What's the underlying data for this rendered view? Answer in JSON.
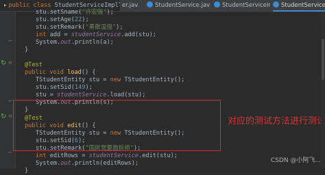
{
  "editor": {
    "class_header": {
      "modifiers": "public class",
      "class_name": "StudentServiceImplTest",
      "brace": "{"
    },
    "tabs": [
      {
        "label": "er.java",
        "close": "×",
        "active": false
      },
      {
        "label": "StudentService.java",
        "close": "×",
        "active": false
      },
      {
        "label": "StudentServiceImpl.java",
        "close": "×",
        "active": false
      },
      {
        "label": "StudentServiceImplT",
        "close": "",
        "active": true
      }
    ]
  },
  "code": {
    "add_block": {
      "l1": {
        "pre": "stu.setSname(",
        "str": "\"许宏强\"",
        "post": ");"
      },
      "l2": {
        "pre": "stu.setAge(",
        "num": "22",
        "post": ");"
      },
      "l3": {
        "pre": "stu.setRemark(",
        "str": "\"勇敢温强\"",
        "post": ");"
      },
      "l4": {
        "kw": "int",
        "pre": " add = ",
        "fld": "studentService",
        "post": ".add(stu);"
      },
      "l5": {
        "pre": "System.",
        "fld": "out",
        "post": ".println(a);"
      },
      "l6": {
        "text": "}"
      }
    },
    "load_block": {
      "ann": "@Test",
      "sig": {
        "kw": "public void",
        "fn": "load",
        "post": "() {"
      },
      "l1": {
        "pre": "TStudentEntity stu = ",
        "kw": "new",
        "post": " TStudentEntity();"
      },
      "l2": {
        "pre": "stu.setSid(",
        "num": "149",
        "post": ");"
      },
      "l3": {
        "pre": "stu = ",
        "fld": "studentService",
        "post": ".load(stu);"
      },
      "l4": {
        "pre": "System.",
        "fld": "out",
        "post": ".println(s);"
      },
      "l5": {
        "text": "}"
      }
    },
    "edit_block": {
      "ann": "@Test",
      "sig": {
        "kw": "public void",
        "fn": "edit",
        "post": "() {"
      },
      "l1": {
        "pre": "TStudentEntity stu = ",
        "kw": "new",
        "post": " TStudentEntity();"
      },
      "l2": {
        "pre": "stu.setSid(",
        "num": "6",
        "post": ");"
      },
      "l3": {
        "pre": "stu.setRemark(",
        "str": "\"国民党要面拆师\"",
        "post": ");"
      },
      "l4": {
        "kw": "int",
        "pre": " editRows = ",
        "fld": "studentService",
        "post": ".edit(stu);"
      },
      "l5": {
        "pre": "System.",
        "fld": "out",
        "post": ".println(editRows);"
      },
      "l6": {
        "text": "}"
      }
    }
  },
  "annotation": {
    "text": "对应的测试方法进行测试",
    "color": "#e03333"
  },
  "watermark": {
    "text": "CSDN @小阿飞..."
  }
}
